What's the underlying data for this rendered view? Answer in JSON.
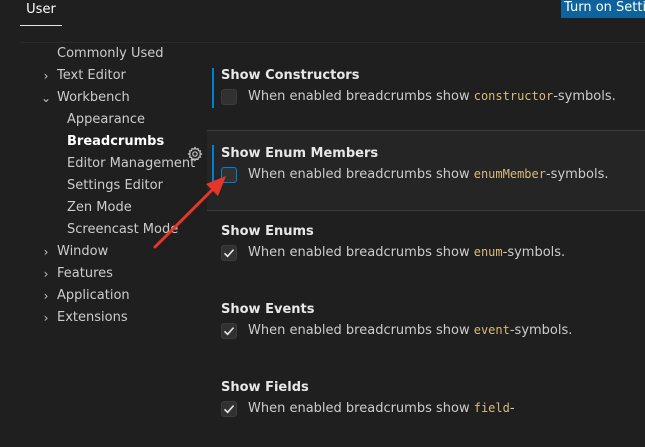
{
  "header": {
    "tab_user": "User",
    "turn_on_button": "Turn on Settin"
  },
  "toc": {
    "commonly_used": "Commonly Used",
    "text_editor": "Text Editor",
    "workbench": "Workbench",
    "appearance": "Appearance",
    "breadcrumbs": "Breadcrumbs",
    "editor_management": "Editor Management",
    "settings_editor": "Settings Editor",
    "zen_mode": "Zen Mode",
    "screencast_mode": "Screencast Mode",
    "window": "Window",
    "features": "Features",
    "application": "Application",
    "extensions": "Extensions"
  },
  "desc_prefix": "When enabled breadcrumbs show ",
  "settings": [
    {
      "title": "Show Constructors",
      "code": "constructor",
      "suffix": "-symbols.",
      "checked": false
    },
    {
      "title": "Show Enum Members",
      "code": "enumMember",
      "suffix": "-symbols.",
      "checked": false
    },
    {
      "title": "Show Enums",
      "code": "enum",
      "suffix": "-symbols.",
      "checked": true
    },
    {
      "title": "Show Events",
      "code": "event",
      "suffix": "-symbols.",
      "checked": true
    },
    {
      "title": "Show Fields",
      "code": "field",
      "suffix": "-",
      "checked": true
    }
  ],
  "colors": {
    "accent": "#007fd4",
    "code": "#d7ba7d",
    "button": "#0e639c",
    "annotation_arrow": "#e8352b"
  }
}
